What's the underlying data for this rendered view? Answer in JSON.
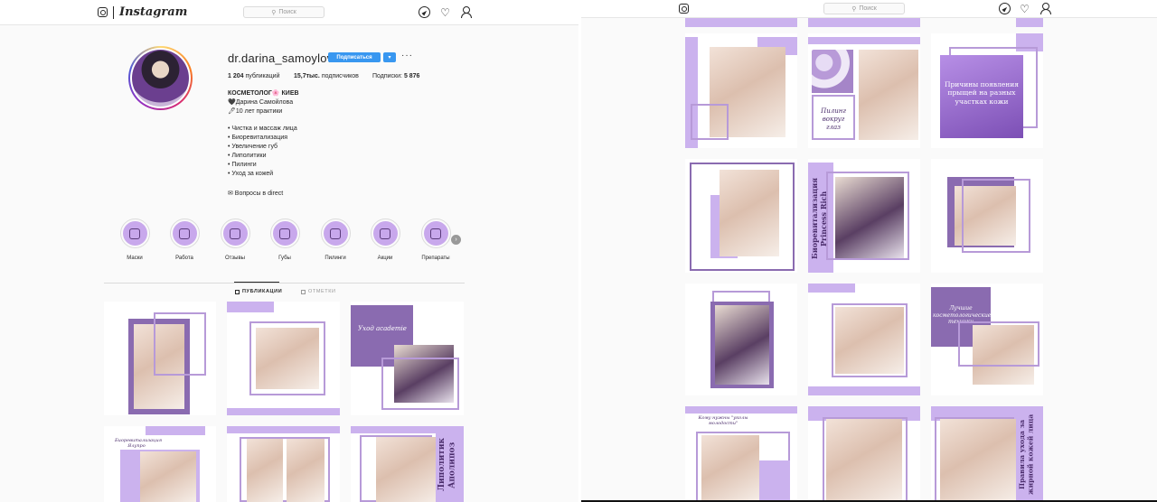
{
  "app": {
    "wordmark": "Instagram",
    "search_placeholder": "Поиск",
    "icons": [
      "instagram-logo-icon",
      "search-icon",
      "compass-icon",
      "heart-icon",
      "profile-icon"
    ]
  },
  "profile": {
    "username": "dr.darina_samoylova",
    "follow_label": "Подписаться",
    "dropdown_label": "▾",
    "more_label": "···",
    "stats": {
      "posts_count": "1 204",
      "posts_label": "публикаций",
      "followers_count": "15,7тыс.",
      "followers_label": "подписчиков",
      "following_label": "Подписки:",
      "following_count": "5 876"
    },
    "bio": [
      "КОСМЕТОЛОГ🌸 КИЕВ",
      "🖤Дарина Самойлова",
      "🖊10 лет практики",
      "",
      "• Чистка и массаж лица",
      "• Биоревитализация",
      "• Увеличение губ",
      "• Липолитики",
      "• Пилинги",
      "• Уход за кожей",
      "",
      "✉ Вопросы в direct"
    ]
  },
  "highlights": [
    "Маски",
    "Работа",
    "Отзывы",
    "Губы",
    "Пилинги",
    "Акции",
    "Препараты"
  ],
  "tabs": {
    "posts": "ПУБЛИКАЦИИ",
    "tagged": "ОТМЕТКИ"
  },
  "posts_left": [
    {
      "text": ""
    },
    {
      "text": ""
    },
    {
      "text": "Уход academie"
    },
    {
      "text": "Биоревитализация Ялупро"
    },
    {
      "text": ""
    },
    {
      "text": "Липолитик Аполипоз"
    }
  ],
  "posts_right": [
    {
      "text": ""
    },
    {
      "text": "Пилинг вокруг глаз"
    },
    {
      "text": "Причины появления прыщей на разных участках кожи"
    },
    {
      "text": ""
    },
    {
      "text": "Биоревитализация Princess Rich"
    },
    {
      "text": ""
    },
    {
      "text": ""
    },
    {
      "text": ""
    },
    {
      "text": "Лучшие косметологические техники"
    },
    {
      "text": "Кому нужны \"уколы молодости\""
    },
    {
      "text": ""
    },
    {
      "text": "Правила ухода за жирной кожей лица"
    }
  ]
}
